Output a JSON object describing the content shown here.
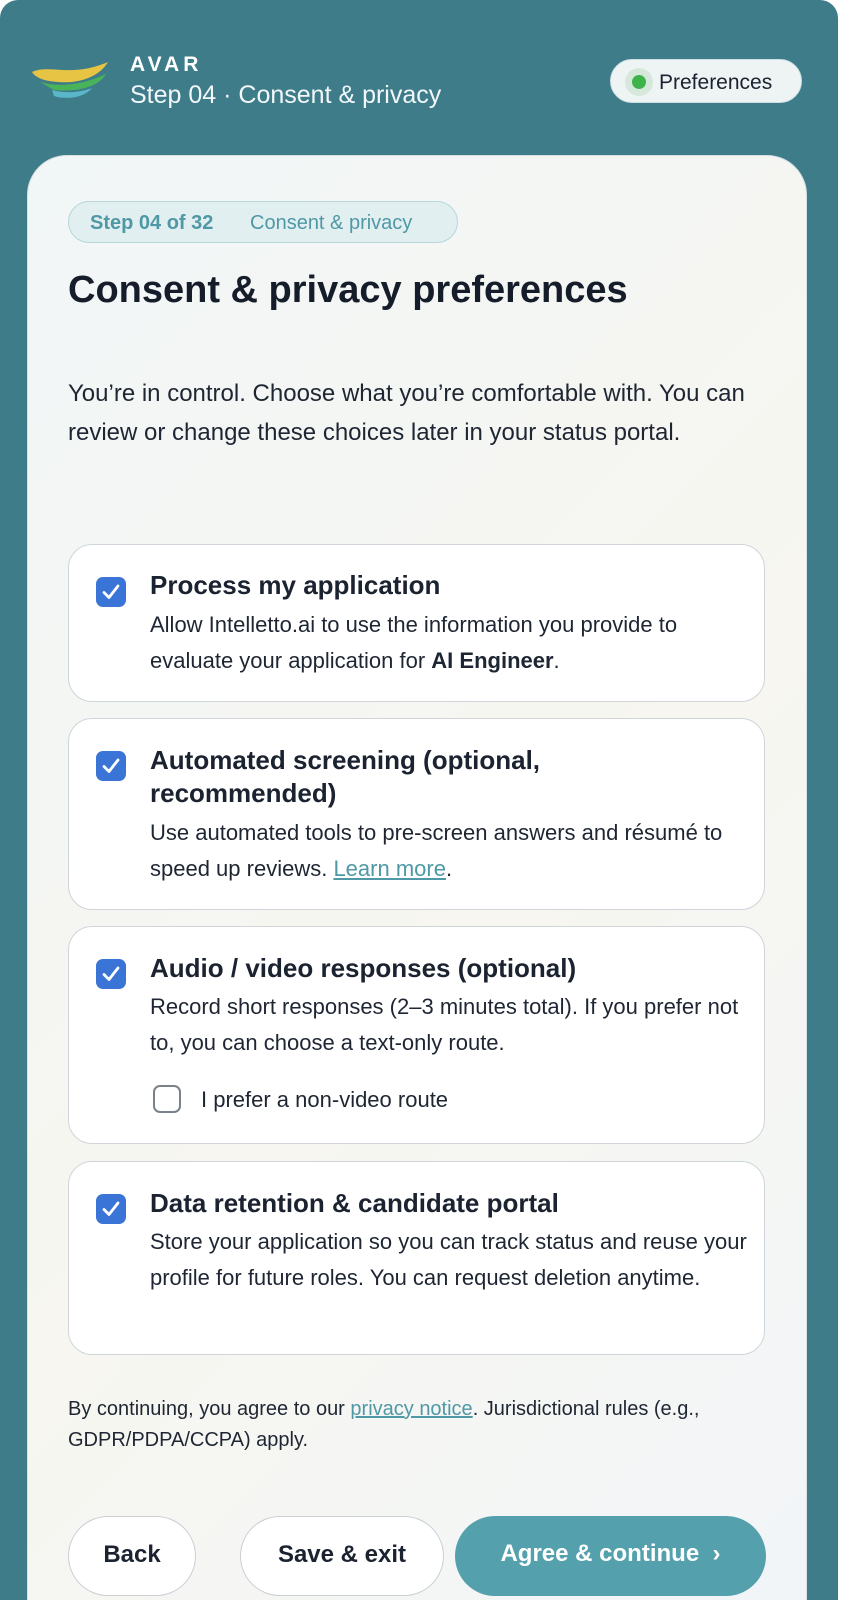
{
  "header": {
    "brand": "AVAR",
    "subtitle": "Step 04 · Consent & privacy",
    "preferences_label": "Preferences",
    "status_color": "#3eb34a"
  },
  "step_chip": {
    "step": "Step 04 of 32",
    "section": "Consent & privacy"
  },
  "page_title": "Consent & privacy preferences",
  "intro": "You’re in control. Choose what you’re comfortable with. You can review or change these choices later in your status portal.",
  "options": [
    {
      "title": "Process my application",
      "desc_before": "Allow Intelletto.ai to use the information you provide to evaluate your application for ",
      "desc_bold": "AI Engineer",
      "desc_after": ".",
      "checked": true
    },
    {
      "title": "Automated screening (optional, recommended)",
      "desc_before": "Use automated tools to pre-screen answers and résumé to speed up reviews. ",
      "link": "Learn more",
      "desc_after": ".",
      "checked": true
    },
    {
      "title": "Audio / video responses (optional)",
      "desc": "Record short responses (2–3 minutes total). If you prefer not to, you can choose a text-only route.",
      "checked": true,
      "sub_option": {
        "label": "I prefer a non-video route",
        "checked": false
      }
    },
    {
      "title": "Data retention & candidate portal",
      "desc": "Store your application so you can track status and reuse your profile for future roles. You can request deletion anytime.",
      "checked": true
    }
  ],
  "legal": {
    "before": "By continuing, you agree to our ",
    "link": "privacy notice",
    "after": ". Jurisdictional rules (e.g., GDPR/PDPA/CCPA) apply."
  },
  "buttons": {
    "back": "Back",
    "save": "Save & exit",
    "agree": "Agree & continue",
    "agree_icon": "›"
  },
  "colors": {
    "frame": "#3e7c8a",
    "accent": "#54a1ad",
    "checkbox": "#3a74d6"
  }
}
